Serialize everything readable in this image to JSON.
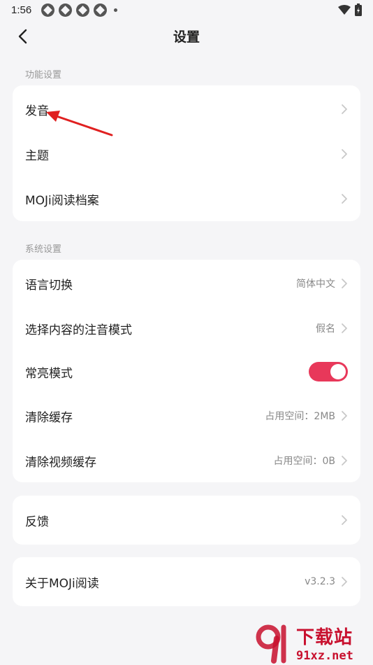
{
  "status_bar": {
    "time": "1:56"
  },
  "header": {
    "title": "设置"
  },
  "sections": {
    "function": {
      "label": "功能设置",
      "items": [
        {
          "label": "发音"
        },
        {
          "label": "主题"
        },
        {
          "label": "MOJi阅读档案"
        }
      ]
    },
    "system": {
      "label": "系统设置",
      "items": [
        {
          "label": "语言切换",
          "value": "简体中文"
        },
        {
          "label": "选择内容的注音模式",
          "value": "假名"
        },
        {
          "label": "常亮模式",
          "toggle_on": true
        },
        {
          "label": "清除缓存",
          "value": "占用空间：2MB"
        },
        {
          "label": "清除视频缓存",
          "value": "占用空间：0B"
        }
      ]
    },
    "feedback": {
      "label": "反馈"
    },
    "about": {
      "label": "关于MOJi阅读",
      "value": "v3.2.3"
    }
  },
  "watermark": {
    "text": "下载站",
    "url": "91xz.net"
  },
  "colors": {
    "accent": "#e8385a",
    "background": "#f5f5f7",
    "card": "#ffffff",
    "annotation_arrow": "#e02020"
  },
  "icons": {
    "back": "chevron-left-icon",
    "row_arrow": "chevron-right-icon"
  }
}
